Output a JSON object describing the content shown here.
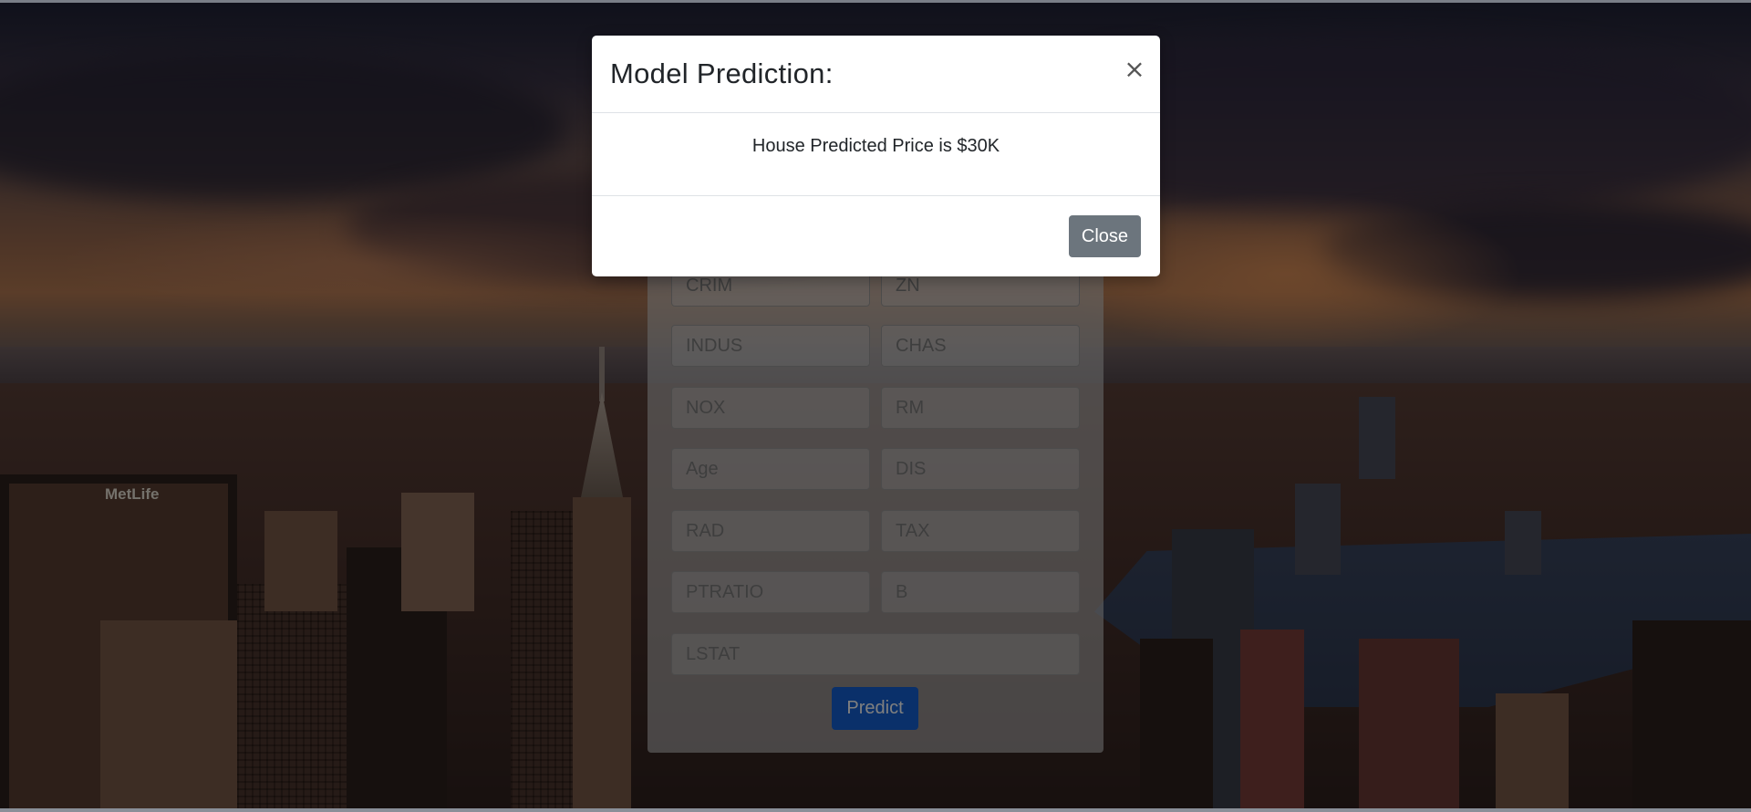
{
  "modal": {
    "title": "Model Prediction:",
    "close_icon": "close-icon",
    "close_glyph": "×",
    "message": "House Predicted Price is $30K",
    "close_button_label": "Close"
  },
  "background": {
    "sign_text": "MetLife"
  },
  "form": {
    "fields": {
      "crim": {
        "placeholder": "CRIM"
      },
      "zn": {
        "placeholder": "ZN"
      },
      "indus": {
        "placeholder": "INDUS"
      },
      "chas": {
        "placeholder": "CHAS"
      },
      "nox": {
        "placeholder": "NOX"
      },
      "rm": {
        "placeholder": "RM"
      },
      "age": {
        "placeholder": "Age"
      },
      "dis": {
        "placeholder": "DIS"
      },
      "rad": {
        "placeholder": "RAD"
      },
      "tax": {
        "placeholder": "TAX"
      },
      "ptratio": {
        "placeholder": "PTRATIO"
      },
      "b": {
        "placeholder": "B"
      },
      "lstat": {
        "placeholder": "LSTAT"
      }
    },
    "predict_label": "Predict"
  },
  "colors": {
    "primary": "#1461d4",
    "secondary": "#6c757d",
    "modal_bg": "#ffffff"
  }
}
